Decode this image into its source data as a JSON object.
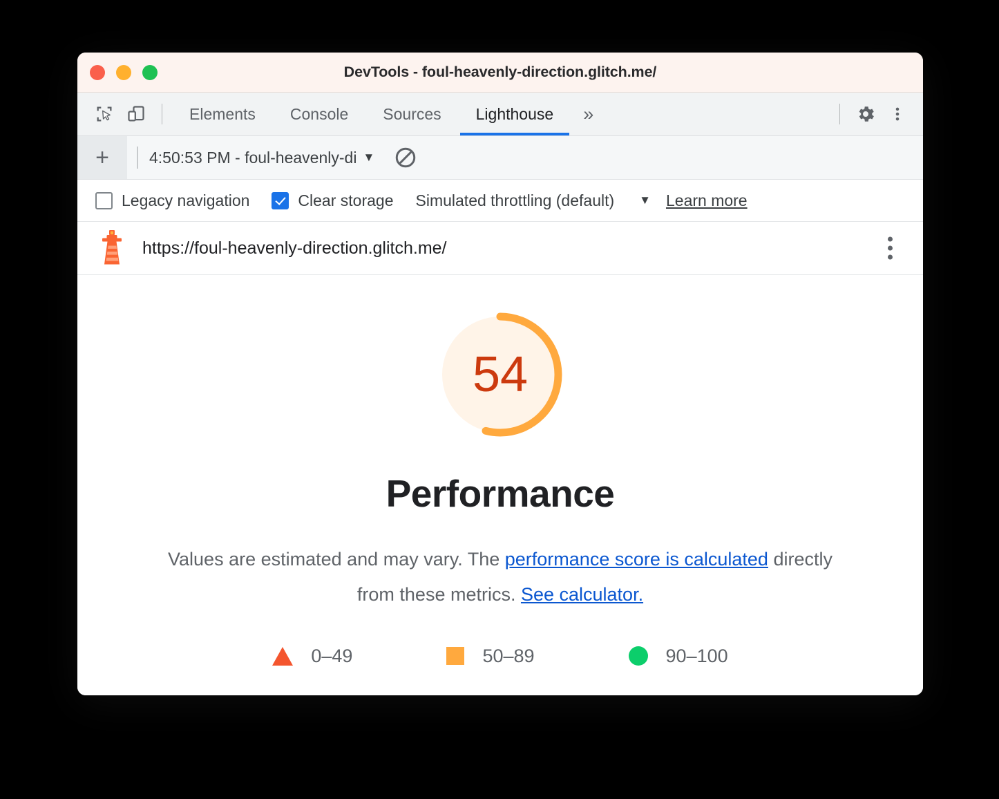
{
  "window": {
    "title": "DevTools - foul-heavenly-direction.glitch.me/",
    "traffic_lights": [
      "close",
      "minimize",
      "zoom"
    ],
    "colors": {
      "titlebar_bg": "#fdf3ef",
      "close": "#fa5f4b",
      "minimize": "#ffb02e",
      "zoom": "#1ec153"
    }
  },
  "devtools_tabs": {
    "left_icons": [
      {
        "name": "inspect-element-icon"
      },
      {
        "name": "device-toolbar-icon"
      }
    ],
    "tabs": [
      {
        "label": "Elements",
        "active": false
      },
      {
        "label": "Console",
        "active": false
      },
      {
        "label": "Sources",
        "active": false
      },
      {
        "label": "Lighthouse",
        "active": true
      }
    ],
    "more_tabs_label": "»",
    "right_icons": [
      {
        "name": "settings-gear-icon"
      },
      {
        "name": "more-options-icon"
      }
    ],
    "active_underline_color": "#1a73e8"
  },
  "run_toolbar": {
    "add_label": "+",
    "run_selected": "4:50:53 PM - foul-heavenly-di",
    "caret": "▼",
    "clear_icon": "no-entry-clear-icon"
  },
  "settings": {
    "legacy_navigation": {
      "label": "Legacy navigation",
      "checked": false
    },
    "clear_storage": {
      "label": "Clear storage",
      "checked": true
    },
    "throttling": {
      "label": "Simulated throttling (default)",
      "caret": "▼"
    },
    "learn_more": "Learn more"
  },
  "report_header": {
    "icon": "lighthouse-icon",
    "url": "https://foul-heavenly-direction.glitch.me/",
    "menu_icon": "more-options-icon"
  },
  "report": {
    "score": "54",
    "category": "Performance",
    "description": {
      "part1": "Values are estimated and may vary. The ",
      "link1": "performance score is calculated",
      "part2": " directly from these metrics. ",
      "link2": "See calculator."
    },
    "legend": [
      {
        "shape": "triangle",
        "label": "0–49",
        "color": "#f4552e"
      },
      {
        "shape": "square",
        "label": "50–89",
        "color": "#ffa93e"
      },
      {
        "shape": "circle",
        "label": "90–100",
        "color": "#0cce6b"
      }
    ],
    "gauge": {
      "value": 54,
      "arc_color": "#ffa93e",
      "track_color": "#fff4e8",
      "number_color": "#cc3a0e"
    }
  }
}
